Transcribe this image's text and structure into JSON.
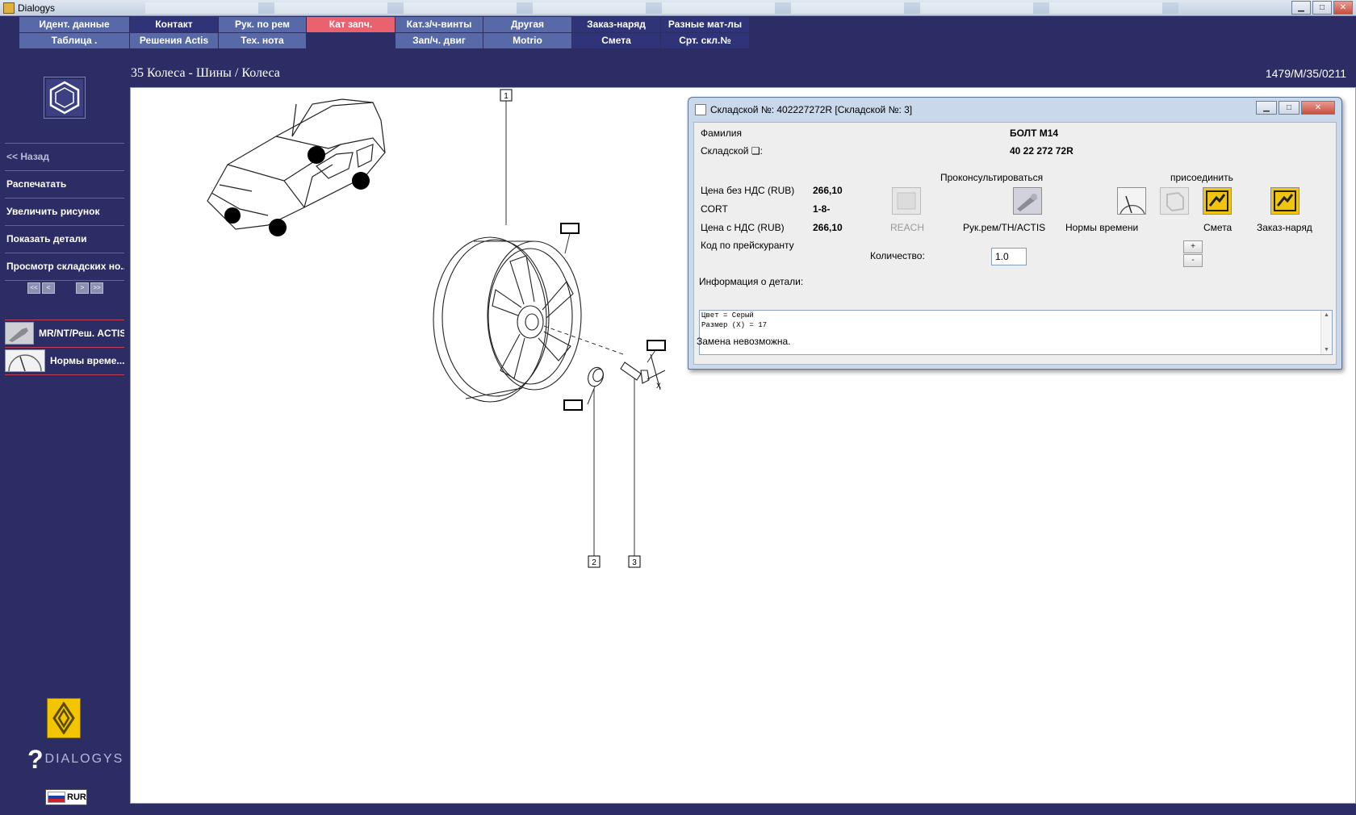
{
  "window": {
    "title": "Dialogys",
    "min": "▁",
    "max": "□",
    "close": "✕"
  },
  "menu": {
    "row1": [
      {
        "label": "Идент. данные",
        "state": "blue"
      },
      {
        "label": "Контакт",
        "state": "dark"
      },
      {
        "label": "Рук. по рем",
        "state": "blue"
      },
      {
        "label": "Кат запч.",
        "state": "active"
      },
      {
        "label": "Кат.з/ч-винты",
        "state": "blue"
      },
      {
        "label": "Другая",
        "state": "blue"
      },
      {
        "label": "Заказ-наряд",
        "state": "dark"
      },
      {
        "label": "Разные мат-лы",
        "state": "dark"
      }
    ],
    "row2": [
      {
        "label": "Таблица .",
        "state": "blue"
      },
      {
        "label": "Решения Actis",
        "state": "blue"
      },
      {
        "label": "Тех. нота",
        "state": "blue"
      },
      {
        "label": "",
        "state": "empty"
      },
      {
        "label": "Зап/ч. двиг",
        "state": "blue"
      },
      {
        "label": "Motrio",
        "state": "blue"
      },
      {
        "label": "Смета",
        "state": "dark"
      },
      {
        "label": "Срт. скл.№",
        "state": "dark"
      }
    ]
  },
  "breadcrumb": "35 Колеса - Шины / Колеса",
  "reference": "1479/M/35/0211",
  "sidebar": {
    "items": [
      {
        "label": "<< Назад",
        "dim": true
      },
      {
        "label": "Распечатать",
        "dim": false
      },
      {
        "label": "Увеличить рисунок",
        "dim": false
      },
      {
        "label": "Показать детали",
        "dim": false
      },
      {
        "label": "Просмотр складских но...",
        "dim": false
      }
    ],
    "pager": [
      "<<",
      "<",
      "",
      ">",
      ">>"
    ],
    "tools": [
      {
        "label": "MR/NT/Реш. ACTIS",
        "icon": "wrench-icon"
      },
      {
        "label": "Нормы време...",
        "icon": "gauge-icon"
      }
    ],
    "brand_word": "DIALOGYS",
    "brand_q": "?",
    "currency": "RUR"
  },
  "diagram": {
    "callouts": [
      "1",
      "2",
      "3"
    ],
    "axis_letter": "X"
  },
  "dialog": {
    "title": "Складской №: 402227272R [Складской №: 3]",
    "min": "▁",
    "max": "□",
    "close": "✕",
    "family_label": "Фамилия",
    "family_value": "БОЛТ M14",
    "part_label": "Складской ❏:",
    "part_value": "40 22 272 72R",
    "consult_label": "Проконсультироваться",
    "attach_label": "присоединить",
    "price_net_label": "Цена без НДС (RUB)",
    "price_net_value": "266,10",
    "cort_label": "CORT",
    "cort_value": "1-8-",
    "price_gross_label": "Цена с НДС (RUB)",
    "price_gross_value": "266,10",
    "pricelist_label": "Код по прейскуранту",
    "quantity_label": "Количество:",
    "quantity_value": "1.0",
    "plus": "+",
    "minus": "-",
    "actions": [
      {
        "label": "REACH",
        "disabled": true
      },
      {
        "label": "Рук.рем/TH/ACTIS",
        "disabled": false
      },
      {
        "label": "Нормы времени",
        "disabled": false
      },
      {
        "label": "Смета",
        "disabled": false
      },
      {
        "label": "Заказ-наряд",
        "disabled": false
      }
    ],
    "info_label": "Информация о детали:",
    "info_lines": [
      "Цвет = Серый",
      "Размер (X) = 17"
    ],
    "status": "Замена невозможна."
  },
  "colors": {
    "background": "#2d2d66",
    "menu_blue": "#5869a8",
    "menu_dark": "#2f3479",
    "menu_active": "#e8636f",
    "separator": "#c0405a",
    "renault_yellow": "#f2c500"
  }
}
